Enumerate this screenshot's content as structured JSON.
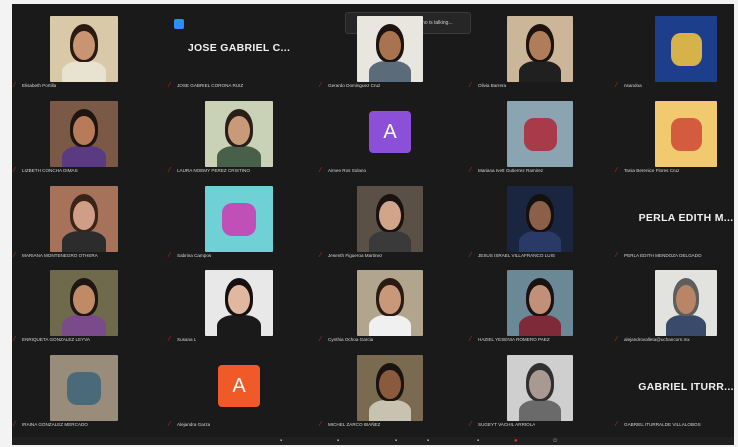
{
  "talking_indicator": "Irineo de la Palacios Serrano is talking...",
  "participants": [
    {
      "name": "Elisabeth Portilla",
      "display": "video",
      "bg": "#d8c9a8",
      "skin": "#c99472",
      "hair": "#2a1a12",
      "shirt": "#e8e2d0"
    },
    {
      "name": "JOSE GABRIEL CORONA RUIZ",
      "display": "name",
      "label": "JOSE GABRIEL C..."
    },
    {
      "name": "Gerardo Dominguez Cruz",
      "display": "video",
      "bg": "#e9e6df",
      "skin": "#a8734f",
      "hair": "#1c1410",
      "shirt": "#5b6b7a"
    },
    {
      "name": "Olivia Barrera",
      "display": "video",
      "bg": "#cbb69a",
      "skin": "#b07d5b",
      "hair": "#1c120e",
      "shirt": "#202020"
    },
    {
      "name": "nsandoa",
      "display": "image",
      "bg": "#1d3e8a",
      "accent": "#d6b34a"
    },
    {
      "name": "LIZBETH CONCHA DIMAS",
      "display": "video",
      "bg": "#7a5a46",
      "skin": "#b77b5a",
      "hair": "#1e1410",
      "shirt": "#5a3a80"
    },
    {
      "name": "LAURA NOEMY PEREZ CRISTINO",
      "display": "video",
      "bg": "#c9d2b6",
      "skin": "#c89a78",
      "hair": "#2a1f18",
      "shirt": "#48604a"
    },
    {
      "name": "Aimee Ros Solano",
      "display": "avatar",
      "letter": "A",
      "color": "#8c4fd8"
    },
    {
      "name": "Mariana Ivett Gutierrez Ramirez",
      "display": "image",
      "bg": "#8aa4b2",
      "accent": "#a83a4a"
    },
    {
      "name": "Tania Berenice Flores Cruz",
      "display": "image",
      "bg": "#f1c96e",
      "accent": "#d35b3e"
    },
    {
      "name": "MARIANA MONTENEGRO OTHERA",
      "display": "video",
      "bg": "#a7725a",
      "skin": "#d09e86",
      "hair": "#3a2418",
      "shirt": "#2c2c2c"
    },
    {
      "name": "Sabrina Campos",
      "display": "image",
      "bg": "#6fd0d6",
      "accent": "#c04fb8"
    },
    {
      "name": "Jesenth Figueroa Martinez",
      "display": "video",
      "bg": "#5a5046",
      "skin": "#d0a58a",
      "hair": "#1a1210",
      "shirt": "#3a3a3a"
    },
    {
      "name": "JESUS ISRAEL VILLAFRANCO LUIS",
      "display": "video",
      "bg": "#1a2640",
      "skin": "#8c6048",
      "hair": "#151010",
      "shirt": "#2a3a66"
    },
    {
      "name": "PERLA EDITH MENDOZA DELGADO",
      "display": "name",
      "label": "PERLA EDITH M..."
    },
    {
      "name": "ENRIQUETA GONZALEZ LEYVA",
      "display": "video",
      "bg": "#6f6a4c",
      "skin": "#c08a66",
      "hair": "#1e1612",
      "shirt": "#7a4a8a"
    },
    {
      "name": "Susana L",
      "display": "video",
      "bg": "#e8e8e8",
      "skin": "#e0b8a0",
      "hair": "#161010",
      "shirt": "#1a1a1a"
    },
    {
      "name": "Cynthia Ochoa Garcia",
      "display": "video",
      "bg": "#b2a58e",
      "skin": "#c9987a",
      "hair": "#2a1a12",
      "shirt": "#f0f0f0"
    },
    {
      "name": "HAZIEL YESENIA ROMERO PAEZ",
      "display": "video",
      "bg": "#6a8896",
      "skin": "#c09078",
      "hair": "#1a1210",
      "shirt": "#7e2a38"
    },
    {
      "name": "alejandrovalleta@uchancorn.mx",
      "display": "video",
      "bg": "#e2e2de",
      "skin": "#b98566",
      "hair": "#5e5e5e",
      "shirt": "#3a4a6a"
    },
    {
      "name": "IRAINA GONZALEZ MERCADO",
      "display": "image",
      "bg": "#9a8c7a",
      "accent": "#4a6a7a"
    },
    {
      "name": "Alejandra Garza",
      "display": "avatar",
      "letter": "A",
      "color": "#f05a28"
    },
    {
      "name": "MICHEL ZARCO IBAÑEZ",
      "display": "video",
      "bg": "#7a6a50",
      "skin": "#8a5a3e",
      "hair": "#1a1410",
      "shirt": "#c8c2b0"
    },
    {
      "name": "SUGEYT VACHIL ARRIOLA",
      "display": "video",
      "bg": "#cfcfcf",
      "skin": "#a89a90",
      "hair": "#303030",
      "shirt": "#6a6a6a"
    },
    {
      "name": "GABRIEL ITURRALDE VILLALOBOS",
      "display": "name",
      "label": "GABRIEL ITURR..."
    }
  ]
}
